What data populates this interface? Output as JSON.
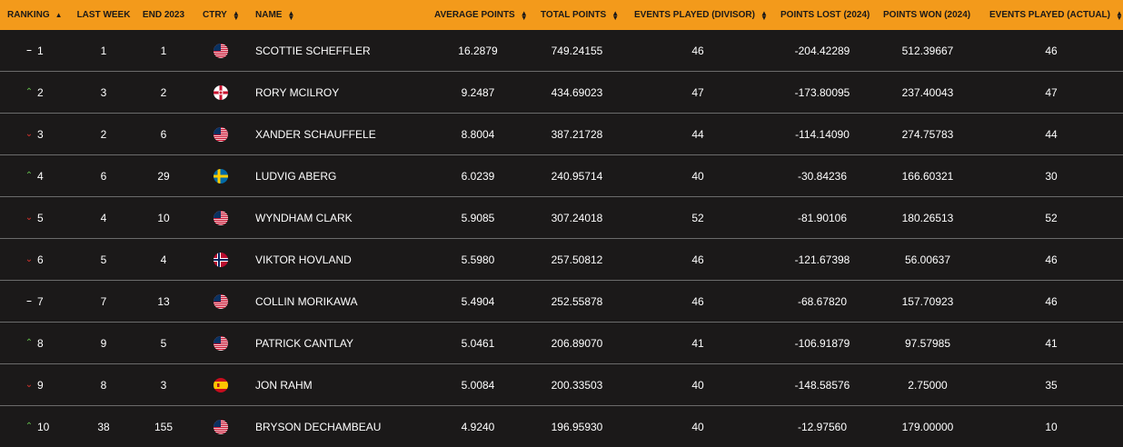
{
  "colors": {
    "header_bg": "#f39a1b",
    "row_bg": "#1b1919",
    "up": "#5fb54a",
    "down": "#d6332d"
  },
  "headers": {
    "ranking": "RANKING",
    "last_week": "LAST WEEK",
    "end_2023": "END 2023",
    "ctry": "CTRY",
    "name": "NAME",
    "avg_points": "AVERAGE POINTS",
    "total_points": "TOTAL POINTS",
    "events_divisor": "EVENTS PLAYED (DIVISOR)",
    "points_lost": "POINTS LOST (2024)",
    "points_won": "POINTS WON (2024)",
    "events_actual": "EVENTS PLAYED (ACTUAL)"
  },
  "rows": [
    {
      "movement": "same",
      "rank": "1",
      "last_week": "1",
      "end_2023": "1",
      "country": "usa",
      "name": "SCOTTIE SCHEFFLER",
      "avg": "16.2879",
      "total": "749.24155",
      "divisor": "46",
      "lost": "-204.42289",
      "won": "512.39667",
      "actual": "46"
    },
    {
      "movement": "up",
      "rank": "2",
      "last_week": "3",
      "end_2023": "2",
      "country": "nir",
      "name": "RORY MCILROY",
      "avg": "9.2487",
      "total": "434.69023",
      "divisor": "47",
      "lost": "-173.80095",
      "won": "237.40043",
      "actual": "47"
    },
    {
      "movement": "down",
      "rank": "3",
      "last_week": "2",
      "end_2023": "6",
      "country": "usa",
      "name": "XANDER SCHAUFFELE",
      "avg": "8.8004",
      "total": "387.21728",
      "divisor": "44",
      "lost": "-114.14090",
      "won": "274.75783",
      "actual": "44"
    },
    {
      "movement": "up",
      "rank": "4",
      "last_week": "6",
      "end_2023": "29",
      "country": "swe",
      "name": "LUDVIG ABERG",
      "avg": "6.0239",
      "total": "240.95714",
      "divisor": "40",
      "lost": "-30.84236",
      "won": "166.60321",
      "actual": "30"
    },
    {
      "movement": "down",
      "rank": "5",
      "last_week": "4",
      "end_2023": "10",
      "country": "usa",
      "name": "WYNDHAM CLARK",
      "avg": "5.9085",
      "total": "307.24018",
      "divisor": "52",
      "lost": "-81.90106",
      "won": "180.26513",
      "actual": "52"
    },
    {
      "movement": "down",
      "rank": "6",
      "last_week": "5",
      "end_2023": "4",
      "country": "nor",
      "name": "VIKTOR HOVLAND",
      "avg": "5.5980",
      "total": "257.50812",
      "divisor": "46",
      "lost": "-121.67398",
      "won": "56.00637",
      "actual": "46"
    },
    {
      "movement": "same",
      "rank": "7",
      "last_week": "7",
      "end_2023": "13",
      "country": "usa",
      "name": "COLLIN MORIKAWA",
      "avg": "5.4904",
      "total": "252.55878",
      "divisor": "46",
      "lost": "-68.67820",
      "won": "157.70923",
      "actual": "46"
    },
    {
      "movement": "up",
      "rank": "8",
      "last_week": "9",
      "end_2023": "5",
      "country": "usa",
      "name": "PATRICK CANTLAY",
      "avg": "5.0461",
      "total": "206.89070",
      "divisor": "41",
      "lost": "-106.91879",
      "won": "97.57985",
      "actual": "41"
    },
    {
      "movement": "down",
      "rank": "9",
      "last_week": "8",
      "end_2023": "3",
      "country": "esp",
      "name": "JON RAHM",
      "avg": "5.0084",
      "total": "200.33503",
      "divisor": "40",
      "lost": "-148.58576",
      "won": "2.75000",
      "actual": "35"
    },
    {
      "movement": "up",
      "rank": "10",
      "last_week": "38",
      "end_2023": "155",
      "country": "usa",
      "name": "BRYSON DECHAMBEAU",
      "avg": "4.9240",
      "total": "196.95930",
      "divisor": "40",
      "lost": "-12.97560",
      "won": "179.00000",
      "actual": "10"
    }
  ]
}
